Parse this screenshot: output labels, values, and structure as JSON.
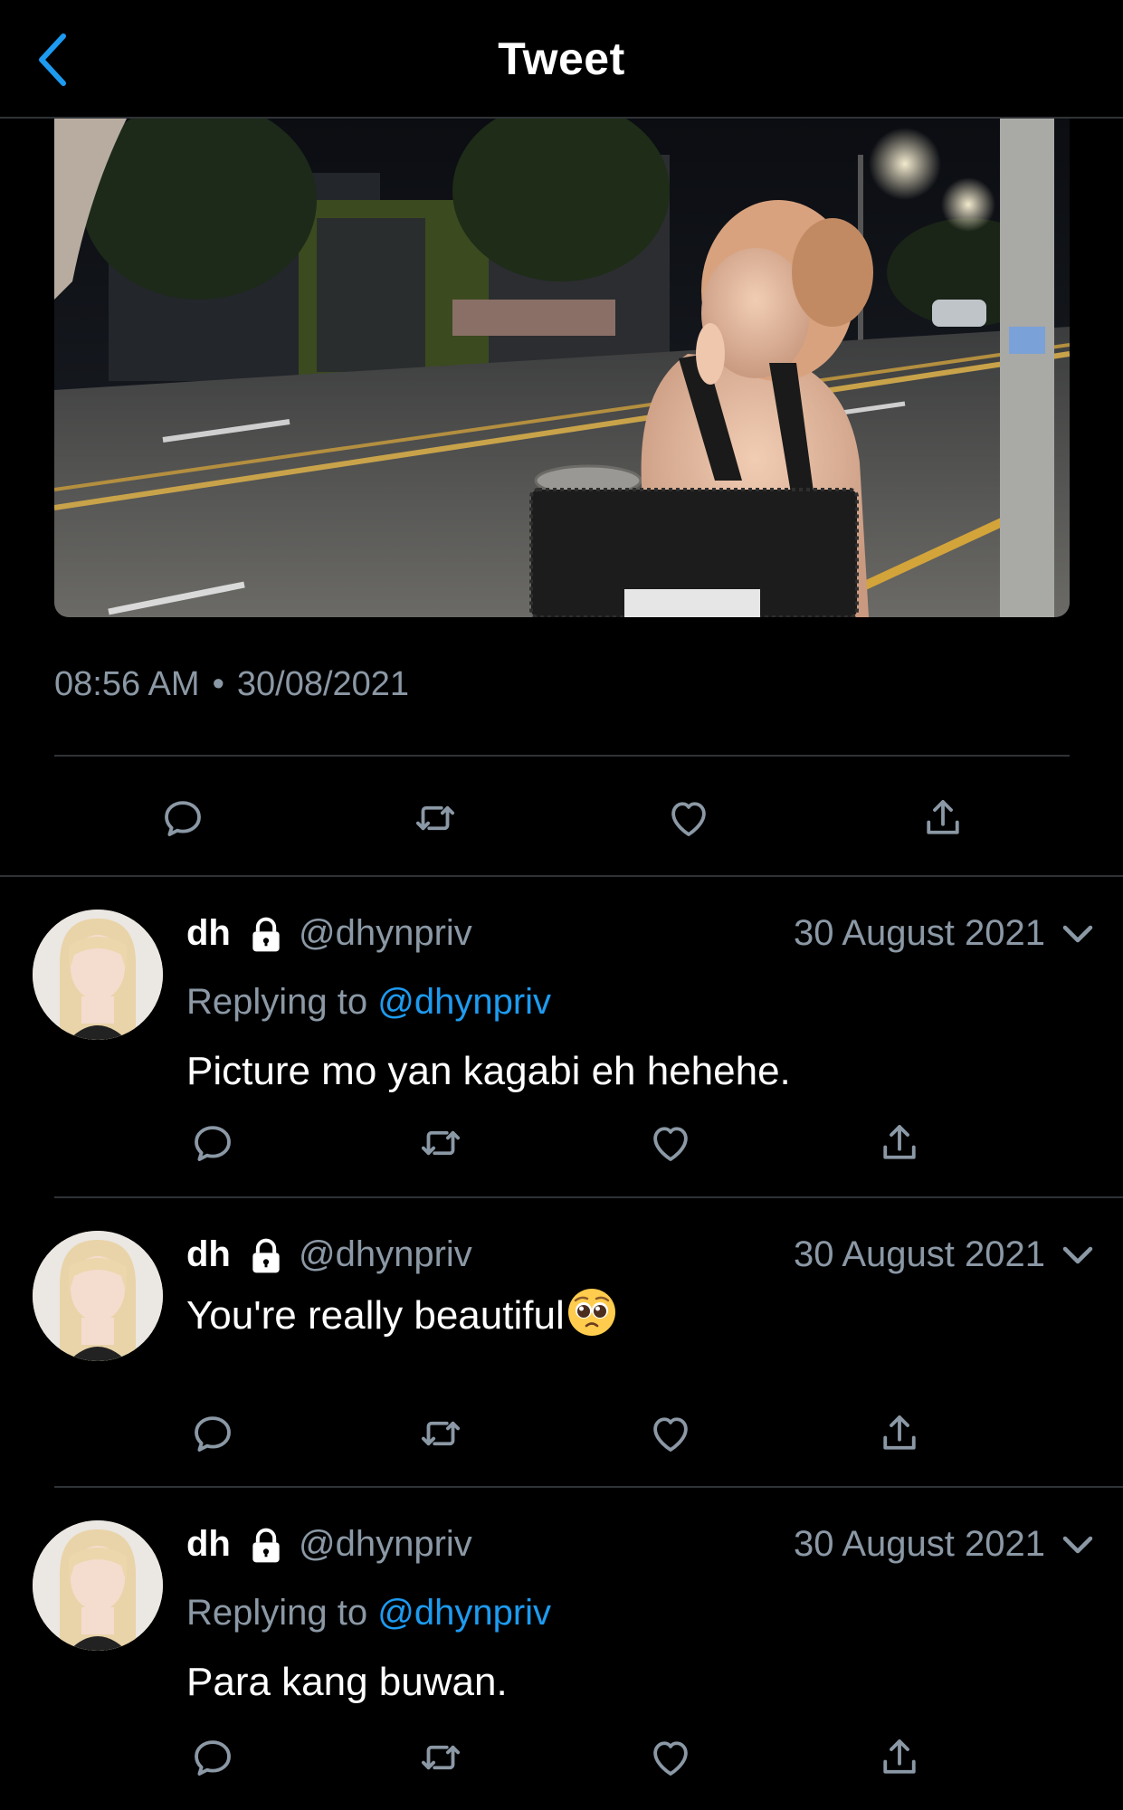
{
  "header": {
    "title": "Tweet",
    "back_icon": "chevron-left-icon",
    "accent_color": "#1d9bf0"
  },
  "main_tweet": {
    "photo_description_text": "",
    "time": "08:56 AM",
    "separator": "•",
    "date": "30/08/2021",
    "actions": [
      "reply-icon",
      "retweet-icon",
      "like-icon",
      "share-icon"
    ]
  },
  "replies": [
    {
      "name": "dh",
      "handle": "@dhynpriv",
      "date": "30 August 2021",
      "replying_prefix": "Replying to",
      "replying_to": "@dhynpriv",
      "text": "Picture mo yan kagabi eh hehehe."
    },
    {
      "name": "dh",
      "handle": "@dhynpriv",
      "date": "30 August 2021",
      "text": "You're really beautiful",
      "emoji": "pleading-face-emoji"
    },
    {
      "name": "dh",
      "handle": "@dhynpriv",
      "date": "30 August 2021",
      "replying_prefix": "Replying to",
      "replying_to": "@dhynpriv",
      "text": "Para kang buwan."
    }
  ],
  "colors": {
    "background": "#000000",
    "secondary_text": "#8b98a5",
    "divider": "#2f3336",
    "link": "#1d9bf0"
  }
}
